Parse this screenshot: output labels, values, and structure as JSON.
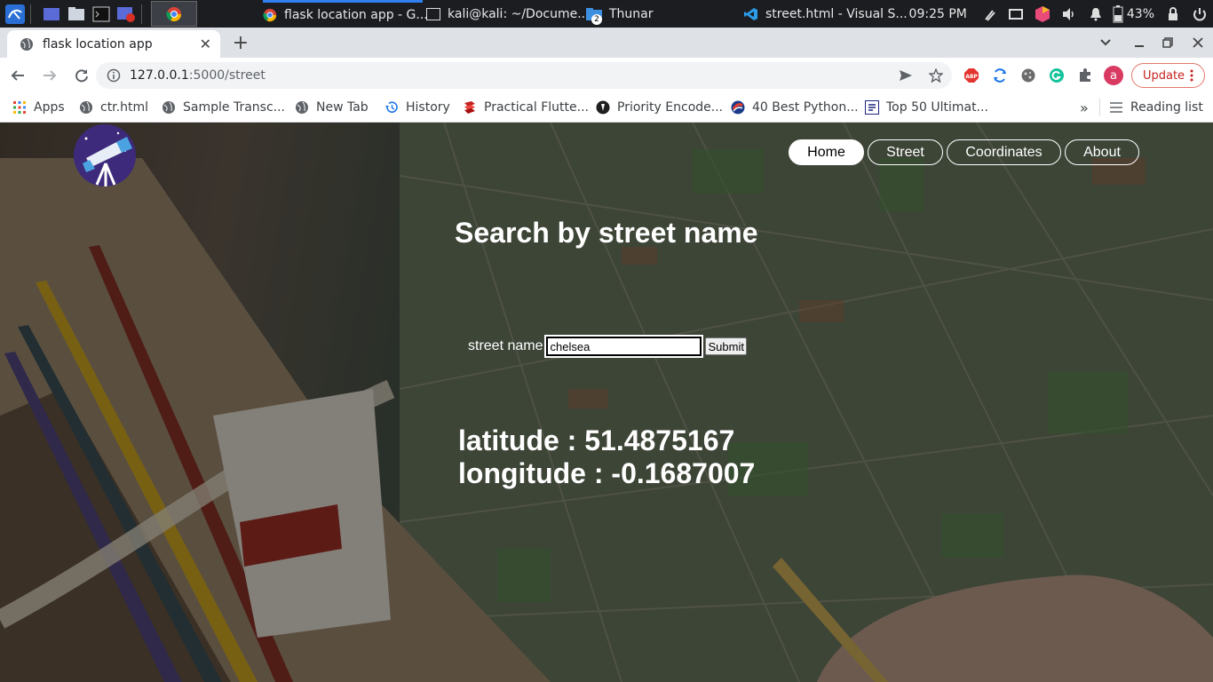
{
  "taskbar": {
    "tasks": [
      {
        "label": "flask location app - G..."
      },
      {
        "label": "kali@kali: ~/Docume..."
      },
      {
        "label": "Thunar",
        "badge": "2"
      },
      {
        "label": "street.html - Visual S..."
      }
    ],
    "clock": "09:25 PM",
    "battery": "43%"
  },
  "browser": {
    "tab_title": "flask location app",
    "tab_close": "✕",
    "new_tab": "+",
    "url_host": "127.0.0.1",
    "url_path": ":5000/street",
    "profile_initial": "a",
    "update_label": "Update",
    "abp_label": "ABP"
  },
  "bookmarks": {
    "items": [
      {
        "label": "Apps"
      },
      {
        "label": "ctr.html"
      },
      {
        "label": "Sample Transc..."
      },
      {
        "label": "New Tab"
      },
      {
        "label": "History"
      },
      {
        "label": "Practical Flutte..."
      },
      {
        "label": "Priority Encode..."
      },
      {
        "label": "40 Best Python..."
      },
      {
        "label": "Top 50 Ultimat..."
      }
    ],
    "more": "»",
    "reading_list": "Reading list"
  },
  "site": {
    "nav": [
      {
        "label": "Home",
        "active": true
      },
      {
        "label": "Street",
        "active": false
      },
      {
        "label": "Coordinates",
        "active": false
      },
      {
        "label": "About",
        "active": false
      }
    ],
    "heading": "Search by street name",
    "form": {
      "label": "street name",
      "value": "chelsea",
      "submit": "Submit"
    },
    "result": {
      "latitude": "latitude : 51.4875167",
      "longitude": "longitude : -0.1687007"
    }
  },
  "colors": {
    "accent": "#2f7ff0",
    "update_red": "#c5221f",
    "logo_bg": "#3d2a7a"
  }
}
